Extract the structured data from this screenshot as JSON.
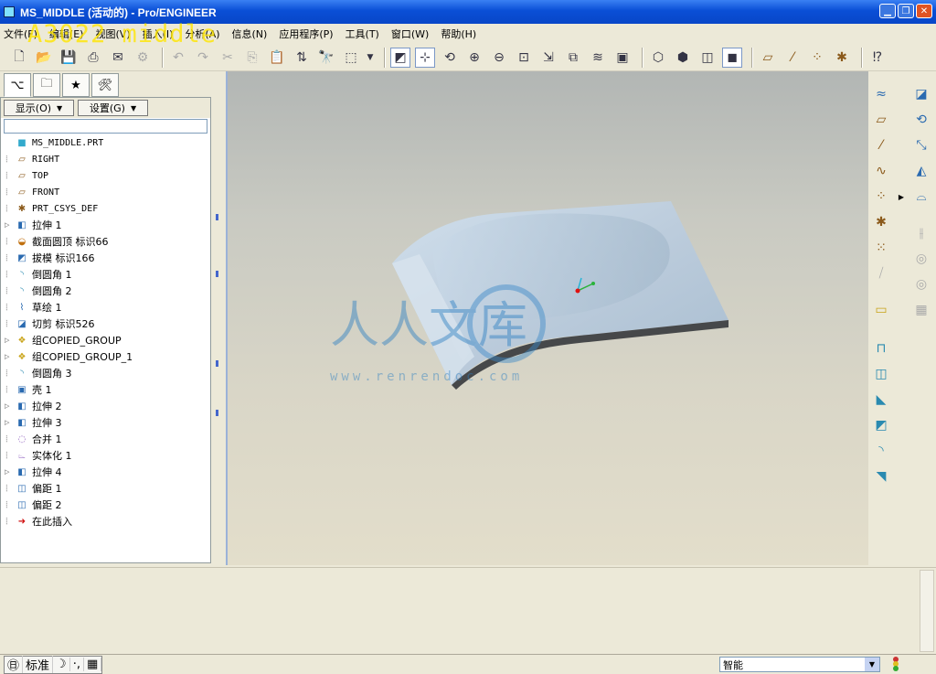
{
  "window": {
    "title": "MS_MIDDLE (活动的) - Pro/ENGINEER"
  },
  "watermark": {
    "overlay_text": "A3022 middle",
    "logo_text": "人人文库",
    "logo_url": "www.renrendoc.com"
  },
  "menu": [
    "文件(F)",
    "编辑(E)",
    "视图(V)",
    "插入(I)",
    "分析(A)",
    "信息(N)",
    "应用程序(P)",
    "工具(T)",
    "窗口(W)",
    "帮助(H)"
  ],
  "panel": {
    "show_label": "显示(O)",
    "settings_label": "设置(G)",
    "tree": [
      {
        "label": "MS_MIDDLE.PRT",
        "icon": "part-icon",
        "expandable": false
      },
      {
        "label": "RIGHT",
        "icon": "datum-plane-icon",
        "expandable": false
      },
      {
        "label": "TOP",
        "icon": "datum-plane-icon",
        "expandable": false
      },
      {
        "label": "FRONT",
        "icon": "datum-plane-icon",
        "expandable": false
      },
      {
        "label": "PRT_CSYS_DEF",
        "icon": "csys-icon",
        "expandable": false
      },
      {
        "label": "拉伸 1",
        "icon": "extrude-icon",
        "expandable": true
      },
      {
        "label": "截面圆顶 标识66",
        "icon": "dome-icon",
        "expandable": false
      },
      {
        "label": "拔模 标识166",
        "icon": "draft-icon",
        "expandable": false
      },
      {
        "label": "倒圆角 1",
        "icon": "round-icon",
        "expandable": false
      },
      {
        "label": "倒圆角 2",
        "icon": "round-icon",
        "expandable": false
      },
      {
        "label": "草绘 1",
        "icon": "sketch-icon",
        "expandable": false
      },
      {
        "label": "切剪 标识526",
        "icon": "cut-icon",
        "expandable": false
      },
      {
        "label": "组COPIED_GROUP",
        "icon": "group-icon",
        "expandable": true
      },
      {
        "label": "组COPIED_GROUP_1",
        "icon": "group-icon",
        "expandable": true
      },
      {
        "label": "倒圆角 3",
        "icon": "round-icon",
        "expandable": false
      },
      {
        "label": "壳 1",
        "icon": "shell-icon",
        "expandable": false
      },
      {
        "label": "拉伸 2",
        "icon": "extrude-icon",
        "expandable": true
      },
      {
        "label": "拉伸 3",
        "icon": "extrude-icon",
        "expandable": true
      },
      {
        "label": "合并 1",
        "icon": "merge-icon",
        "expandable": false
      },
      {
        "label": "实体化 1",
        "icon": "solidify-icon",
        "expandable": false
      },
      {
        "label": "拉伸 4",
        "icon": "extrude-icon",
        "expandable": true
      },
      {
        "label": "偏距 1",
        "icon": "offset-icon",
        "expandable": false
      },
      {
        "label": "偏距 2",
        "icon": "offset-icon",
        "expandable": false
      },
      {
        "label": "在此插入",
        "icon": "insert-here-arrow-icon",
        "expandable": false
      }
    ]
  },
  "status": {
    "ime_mode": "标准",
    "ime_extras": [
      "☽",
      "·,",
      "▦"
    ],
    "filter_value": "智能"
  },
  "colors": {
    "title_blue": "#0a4fd6",
    "model_top": "#bcccdc",
    "model_side": "#46484a",
    "tree_icon": "#8b5a1b"
  }
}
